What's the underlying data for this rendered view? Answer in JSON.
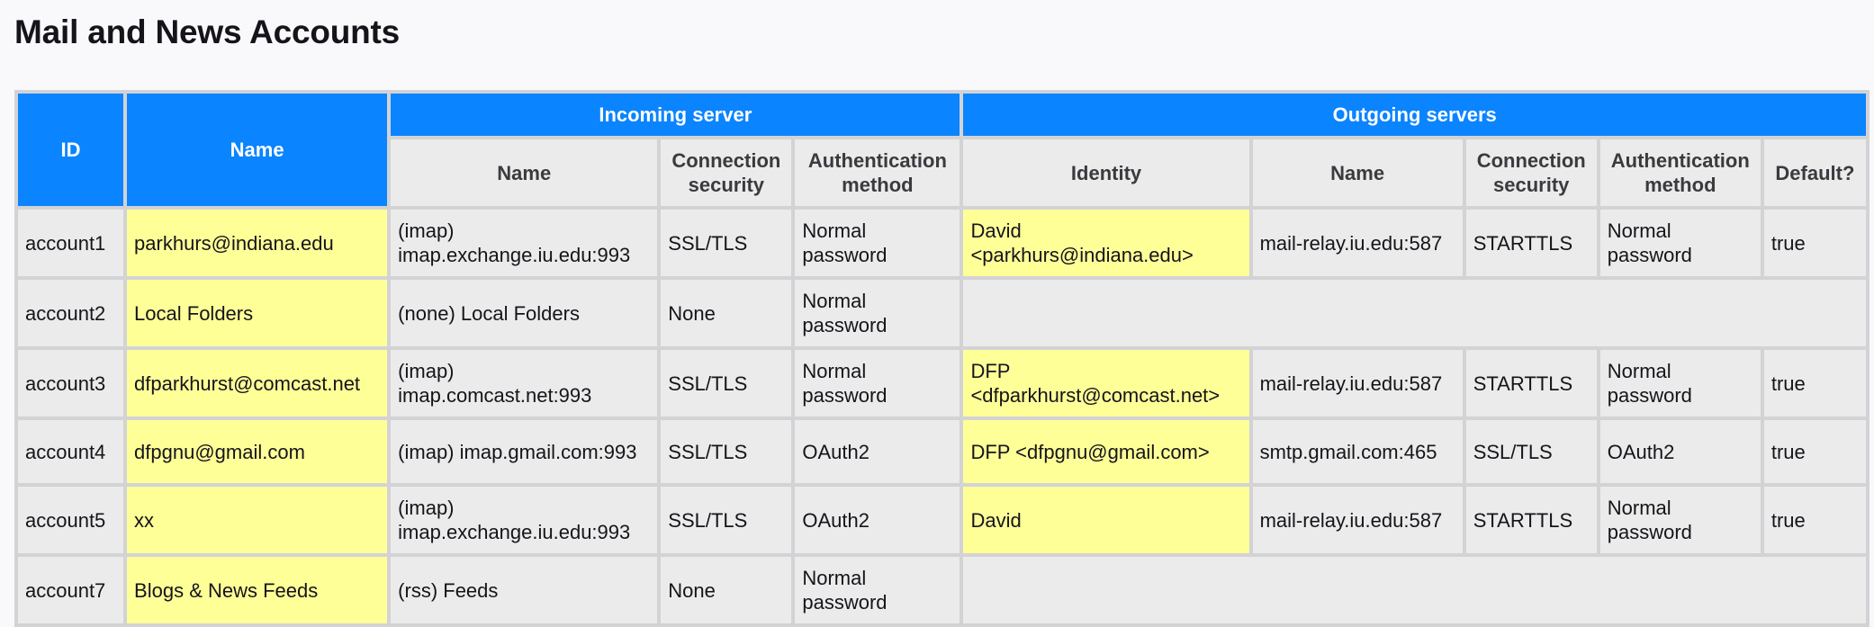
{
  "page": {
    "title": "Mail and News Accounts"
  },
  "table": {
    "header": {
      "id": "ID",
      "name": "Name",
      "incoming_group": "Incoming server",
      "outgoing_group": "Outgoing servers",
      "incoming_columns": [
        "Name",
        "Connection security",
        "Authentication method"
      ],
      "outgoing_columns": [
        "Identity",
        "Name",
        "Connection security",
        "Authentication method",
        "Default?"
      ]
    },
    "rows": [
      {
        "id": "account1",
        "name": "parkhurs@indiana.edu",
        "incoming": {
          "name": "(imap) imap.exchange.iu.edu:993",
          "security": "SSL/TLS",
          "auth": "Normal password"
        },
        "outgoing": {
          "identity": "David <parkhurs@indiana.edu>",
          "name": "mail-relay.iu.edu:587",
          "security": "STARTTLS",
          "auth": "Normal password",
          "default": "true"
        }
      },
      {
        "id": "account2",
        "name": "Local Folders",
        "incoming": {
          "name": "(none) Local Folders",
          "security": "None",
          "auth": "Normal password"
        },
        "outgoing": null
      },
      {
        "id": "account3",
        "name": "dfparkhurst@comcast.net",
        "incoming": {
          "name": "(imap) imap.comcast.net:993",
          "security": "SSL/TLS",
          "auth": "Normal password"
        },
        "outgoing": {
          "identity": "DFP <dfparkhurst@comcast.net>",
          "name": "mail-relay.iu.edu:587",
          "security": "STARTTLS",
          "auth": "Normal password",
          "default": "true"
        }
      },
      {
        "id": "account4",
        "name": "dfpgnu@gmail.com",
        "incoming": {
          "name": "(imap) imap.gmail.com:993",
          "security": "SSL/TLS",
          "auth": "OAuth2"
        },
        "outgoing": {
          "identity": "DFP <dfpgnu@gmail.com>",
          "name": "smtp.gmail.com:465",
          "security": "SSL/TLS",
          "auth": "OAuth2",
          "default": "true"
        }
      },
      {
        "id": "account5",
        "name": "xx",
        "incoming": {
          "name": "(imap) imap.exchange.iu.edu:993",
          "security": "SSL/TLS",
          "auth": "OAuth2"
        },
        "outgoing": {
          "identity": "David",
          "name": "mail-relay.iu.edu:587",
          "security": "STARTTLS",
          "auth": "Normal password",
          "default": "true"
        }
      },
      {
        "id": "account7",
        "name": "Blogs & News Feeds",
        "incoming": {
          "name": "(rss) Feeds",
          "security": "None",
          "auth": "Normal password"
        },
        "outgoing": null
      }
    ]
  },
  "colors": {
    "header_blue": "#0a84ff",
    "highlight_yellow": "#ffff98",
    "cell_gray": "#ebebeb",
    "border_gray": "#d3d3d6"
  }
}
